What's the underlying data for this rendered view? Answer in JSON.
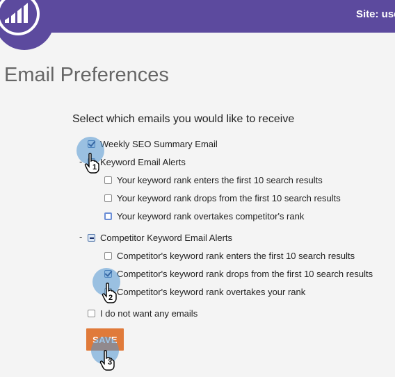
{
  "header": {
    "site_label": "Site: user"
  },
  "page": {
    "title": "Email Preferences",
    "instructions": "Select which emails you would like to receive"
  },
  "options": {
    "weekly": "Weekly SEO Summary Email",
    "keyword_group_toggle": "-",
    "keyword_group": "Keyword Email Alerts",
    "keyword_items": [
      "Your keyword rank enters the first 10 search results",
      "Your keyword rank drops from the first 10 search results",
      "Your keyword rank overtakes competitor's rank"
    ],
    "competitor_group_toggle": "-",
    "competitor_group": "Competitor Keyword Email Alerts",
    "competitor_items": [
      "Competitor's keyword rank enters the first 10 search results",
      "Competitor's keyword rank drops from the first 10 search results",
      "Competitor's keyword rank overtakes your rank"
    ],
    "none": "I do not want any emails"
  },
  "actions": {
    "save_label": "SAVE"
  },
  "annotations": {
    "steps": [
      "1",
      "2",
      "3"
    ]
  },
  "colors": {
    "header": "#5c4a9e",
    "save_button": "#e07a3a",
    "touch_marker": "#5096d2"
  },
  "icons": {
    "logo": "bar-chart-logo-icon",
    "pointer": "hand-pointer-icon"
  }
}
